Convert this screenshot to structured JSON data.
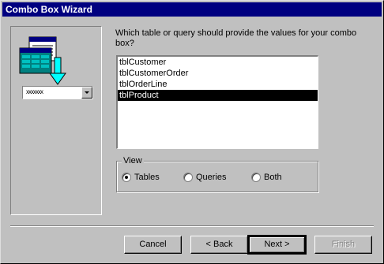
{
  "window": {
    "title": "Combo Box Wizard"
  },
  "prompt": "Which table or query should provide the values for your combo box?",
  "list": {
    "items": [
      "tblCustomer",
      "tblCustomerOrder",
      "tblOrderLine",
      "tblProduct"
    ],
    "selected_index": 3
  },
  "view": {
    "label": "View",
    "options": [
      "Tables",
      "Queries",
      "Both"
    ],
    "selected": "Tables"
  },
  "illustration": {
    "combo_text": "xxxxxxx"
  },
  "buttons": {
    "cancel": "Cancel",
    "back": "< Back",
    "next": "Next >",
    "finish": "Finish"
  },
  "colors": {
    "titlebar": "#000080",
    "dialog_face": "#c0c0c0",
    "selection": "#000000",
    "illustration_accent": "#00c0c0"
  }
}
